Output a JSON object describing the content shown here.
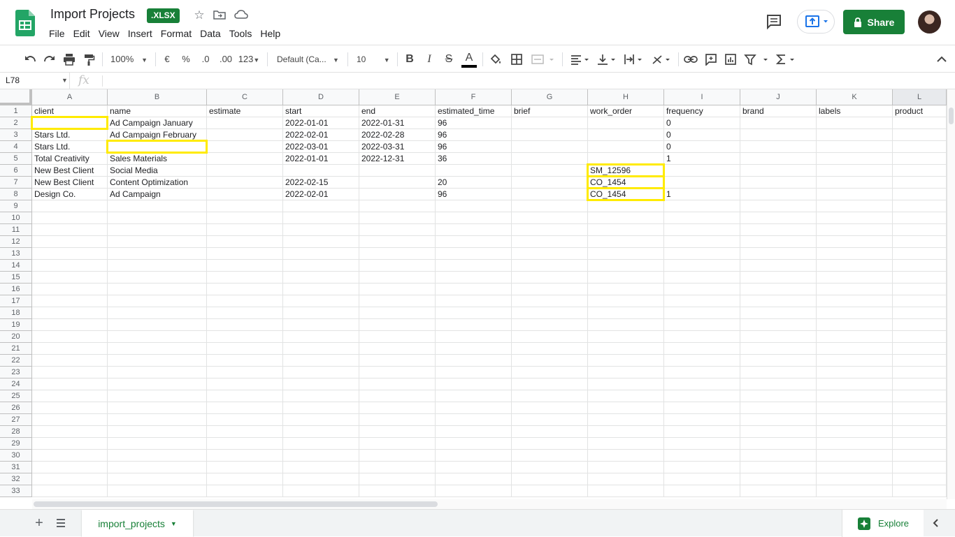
{
  "app": {
    "title": "Import Projects",
    "badge": ".XLSX",
    "menu": [
      "File",
      "Edit",
      "View",
      "Insert",
      "Format",
      "Data",
      "Tools",
      "Help"
    ],
    "share_label": "Share",
    "colors": {
      "brand_green": "#188038",
      "highlight_yellow": "#ffeb00"
    }
  },
  "toolbar": {
    "zoom": "100%",
    "currency": "€",
    "percent": "%",
    "decrease_decimal": ".0",
    "increase_decimal": ".00",
    "more_formats": "123",
    "font": "Default (Ca...",
    "font_size": "10",
    "bold": "B",
    "italic": "I",
    "strikethrough": "S",
    "text_color": "A"
  },
  "formula_bar": {
    "cell_ref": "L78",
    "fx": "fx",
    "value": ""
  },
  "grid": {
    "columns": [
      "A",
      "B",
      "C",
      "D",
      "E",
      "F",
      "G",
      "H",
      "I",
      "J",
      "K",
      "L"
    ],
    "row_count": 33,
    "rows": [
      [
        "client",
        "name",
        "estimate",
        "start",
        "end",
        "estimated_time",
        "brief",
        "work_order",
        "frequency",
        "brand",
        "labels",
        "product"
      ],
      [
        "",
        "Ad Campaign January",
        "",
        "2022-01-01",
        "2022-01-31",
        "96",
        "",
        "",
        "0",
        "",
        "",
        ""
      ],
      [
        "Stars Ltd.",
        "Ad Campaign February",
        "",
        "2022-02-01",
        "2022-02-28",
        "96",
        "",
        "",
        "0",
        "",
        "",
        ""
      ],
      [
        "Stars Ltd.",
        "",
        "",
        "2022-03-01",
        "2022-03-31",
        "96",
        "",
        "",
        "0",
        "",
        "",
        ""
      ],
      [
        "Total Creativity",
        "Sales Materials",
        "",
        "2022-01-01",
        "2022-12-31",
        "36",
        "",
        "",
        "1",
        "",
        "",
        ""
      ],
      [
        "New Best Client",
        "Social Media",
        "",
        "",
        "",
        "",
        "",
        "SM_12596",
        "",
        "",
        "",
        ""
      ],
      [
        "New Best Client",
        "Content Optimization",
        "",
        "2022-02-15",
        "",
        "20",
        "",
        "CO_1454",
        "",
        "",
        "",
        ""
      ],
      [
        "Design Co.",
        "Ad Campaign",
        "",
        "2022-02-01",
        "",
        "96",
        "",
        "CO_1454",
        "1",
        "",
        "",
        ""
      ]
    ],
    "highlighted_cells": [
      "A2",
      "B4",
      "H6",
      "H7",
      "H8"
    ]
  },
  "footer": {
    "sheet_tab": "import_projects",
    "explore": "Explore"
  }
}
